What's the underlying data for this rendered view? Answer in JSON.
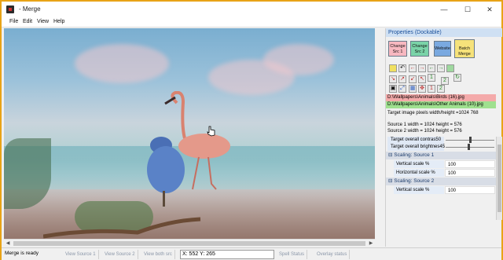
{
  "window": {
    "title": "- Merge",
    "minimize_glyph": "—",
    "maximize_glyph": "☐",
    "close_glyph": "✕"
  },
  "menu": [
    "File",
    "Edit",
    "View",
    "Help"
  ],
  "properties": {
    "title": "Properties (Dockable)",
    "toolbar": {
      "change_src1": "Change Src 1",
      "change_src2": "Change Src 2",
      "website": "Website",
      "batch_merge": "Batch Merge"
    },
    "path_src1": "D:\\Wallpapers\\Animals\\Birds (16).jpg",
    "path_src2": "D:\\Wallpapers\\Animals\\Other Animals (10).jpg",
    "target_size": "Target image pixels width/height =1024 768",
    "source1_size": "Source 1 width = 1024  height = 576",
    "source2_size": "Source 2 width = 1024  height = 576",
    "contrast_label": "Target overall contras50",
    "contrast_value": 50,
    "brightness_label": "Target overall brightnes45",
    "brightness_value": 45,
    "sections": [
      {
        "title": "Scaling: Source 1",
        "rows": [
          {
            "label": "Vertical scale %",
            "value": "100"
          },
          {
            "label": "Horizontal scale %",
            "value": "100"
          }
        ]
      },
      {
        "title": "Scaling: Source 2",
        "rows": [
          {
            "label": "Vertical scale %",
            "value": "100"
          }
        ]
      }
    ],
    "collapse_glyph": "⊟",
    "icon_row2_labels": [
      "1",
      "2"
    ],
    "icon_row3_labels": [
      "1",
      "2"
    ]
  },
  "status": {
    "ready": "Merge is ready",
    "view_source1": "View Source 1",
    "view_source2": "View Source 2",
    "view_both": "View both src",
    "coords": "X: 552 Y: 265",
    "spell_status": "Spell Status",
    "overlay_status": "Overlay status"
  },
  "colors": {
    "window_border": "#e8a317",
    "path_src1_bg": "#f4aaaa",
    "path_src2_bg": "#9fe08f",
    "props_title_bg": "#cfe0f3"
  }
}
